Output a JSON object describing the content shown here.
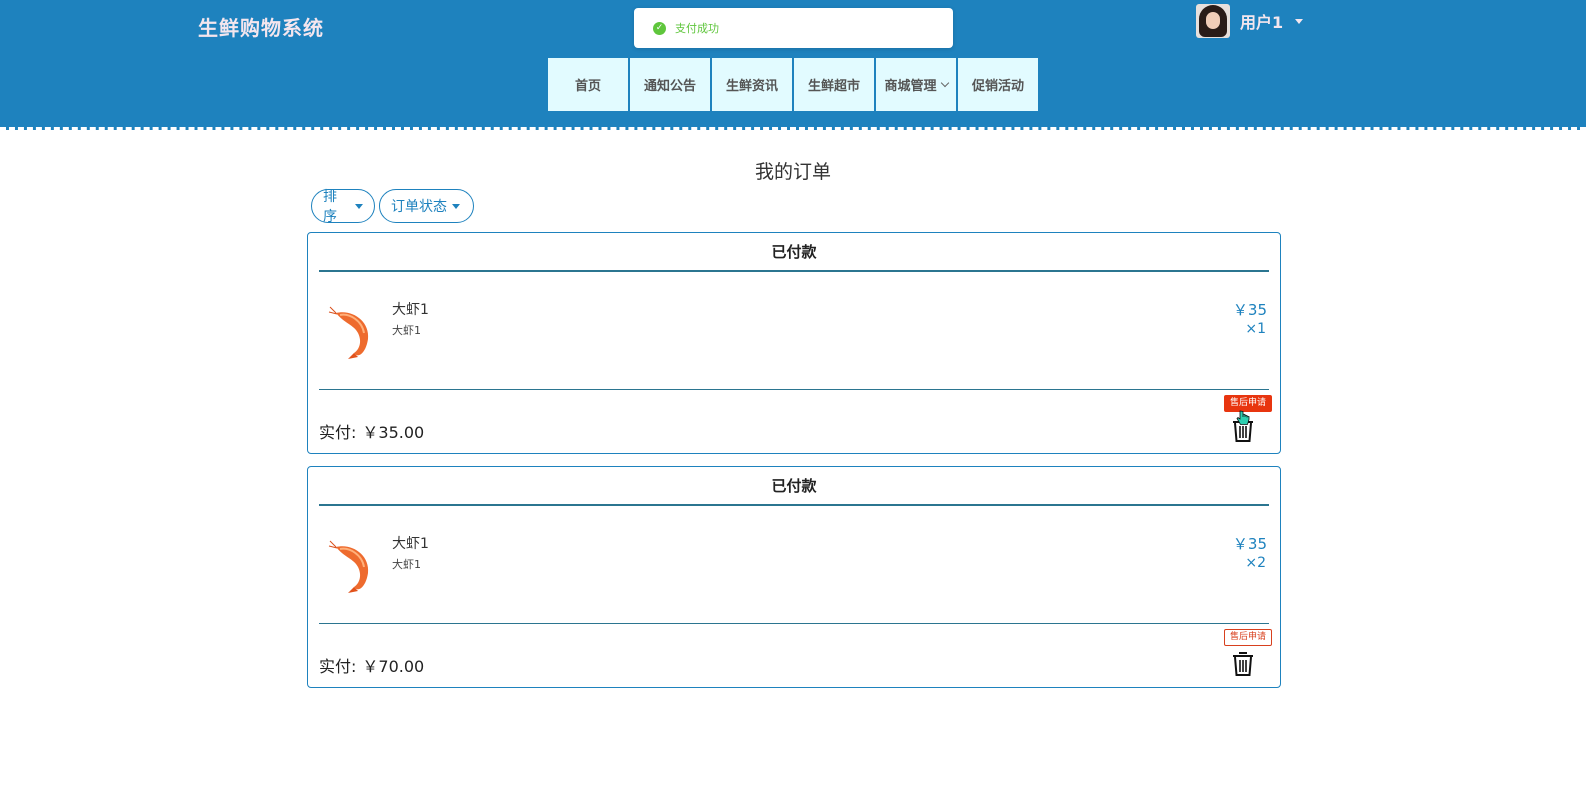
{
  "header": {
    "brand": "生鲜购物系统",
    "toast": "支付成功",
    "user": {
      "name": "用户1"
    },
    "nav": [
      {
        "label": "首页"
      },
      {
        "label": "通知公告"
      },
      {
        "label": "生鲜资讯"
      },
      {
        "label": "生鲜超市"
      },
      {
        "label": "商城管理",
        "has_dropdown": true
      },
      {
        "label": "促销活动"
      }
    ]
  },
  "main": {
    "title": "我的订单",
    "filters": {
      "sort_label": "排序",
      "status_label": "订单状态"
    },
    "orders": [
      {
        "status": "已付款",
        "item": {
          "name": "大虾1",
          "spec": "大虾1",
          "price": "￥35",
          "qty": "×1"
        },
        "paid_label": "实付:",
        "paid_amount": "￥35.00",
        "after_sale_label": "售后申请"
      },
      {
        "status": "已付款",
        "item": {
          "name": "大虾1",
          "spec": "大虾1",
          "price": "￥35",
          "qty": "×2"
        },
        "paid_label": "实付:",
        "paid_amount": "￥70.00",
        "after_sale_label": "售后申请"
      }
    ]
  },
  "colors": {
    "header_bg": "#1e82be",
    "nav_bg": "#e2fbff",
    "accent": "#1e82be",
    "success": "#5fc63c",
    "danger": "#e8350f"
  }
}
